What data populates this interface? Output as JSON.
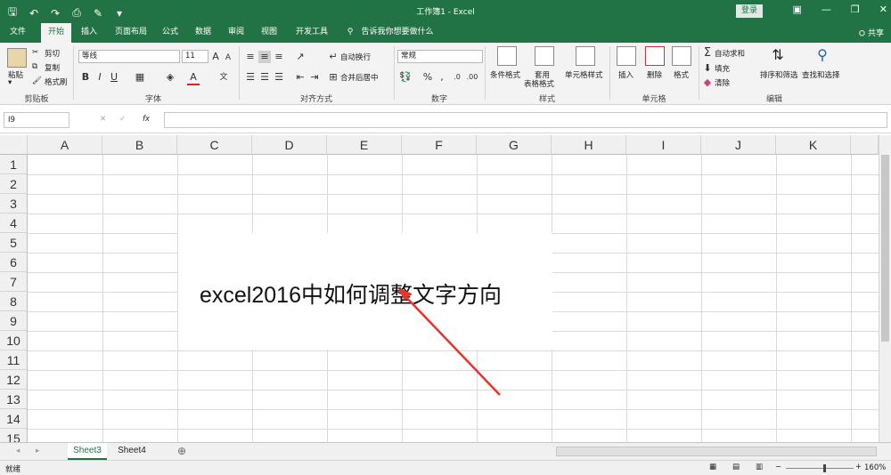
{
  "titlebar": {
    "window_title": "工作簿1 - Excel",
    "login_label": "登录",
    "quick_access": [
      "save-icon",
      "undo-icon",
      "redo-icon",
      "print-preview-icon",
      "paint-icon",
      "customize-icon"
    ]
  },
  "tabs": [
    {
      "label": "文件"
    },
    {
      "label": "开始"
    },
    {
      "label": "插入"
    },
    {
      "label": "页面布局"
    },
    {
      "label": "公式"
    },
    {
      "label": "数据"
    },
    {
      "label": "审阅"
    },
    {
      "label": "视图"
    },
    {
      "label": "开发工具"
    },
    {
      "label": "告诉我你想要做什么"
    }
  ],
  "share_label": "共享",
  "ribbon": {
    "clipboard": {
      "paste": "粘贴",
      "cut": "剪切",
      "copy": "复制",
      "format_painter": "格式刷",
      "group": "剪贴板"
    },
    "font": {
      "name": "等线",
      "size": "11",
      "group": "字体"
    },
    "alignment": {
      "wrap": "自动换行",
      "merge": "合并后居中",
      "group": "对齐方式"
    },
    "number": {
      "format": "常规",
      "group": "数字"
    },
    "styles": {
      "conditional": "条件格式",
      "table_line1": "套用",
      "table_line2": "表格格式",
      "cell_style": "单元格样式",
      "group": "样式"
    },
    "cells": {
      "insert": "插入",
      "delete": "删除",
      "format": "格式",
      "group": "单元格"
    },
    "editing": {
      "autosum": "自动求和",
      "fill": "填充",
      "clear": "清除",
      "sort": "排序和筛选",
      "find": "查找和选择",
      "group": "编辑"
    }
  },
  "formula_bar": {
    "name_box": "I9",
    "fx": "fx",
    "value": ""
  },
  "columns": [
    "A",
    "B",
    "C",
    "D",
    "E",
    "F",
    "G",
    "H",
    "I",
    "J",
    "K"
  ],
  "rows": [
    "1",
    "2",
    "3",
    "4",
    "5",
    "6",
    "7",
    "8",
    "9",
    "10",
    "11",
    "12",
    "13",
    "14",
    "15"
  ],
  "overlay_text": "excel2016中如何调整文字方向",
  "sheets": [
    {
      "name": "Sheet3",
      "active": true
    },
    {
      "name": "Sheet4",
      "active": false
    }
  ],
  "status": {
    "ready": "就绪",
    "zoom": "160%"
  },
  "colors": {
    "accent": "#217346",
    "arrow": "#e8322a"
  }
}
